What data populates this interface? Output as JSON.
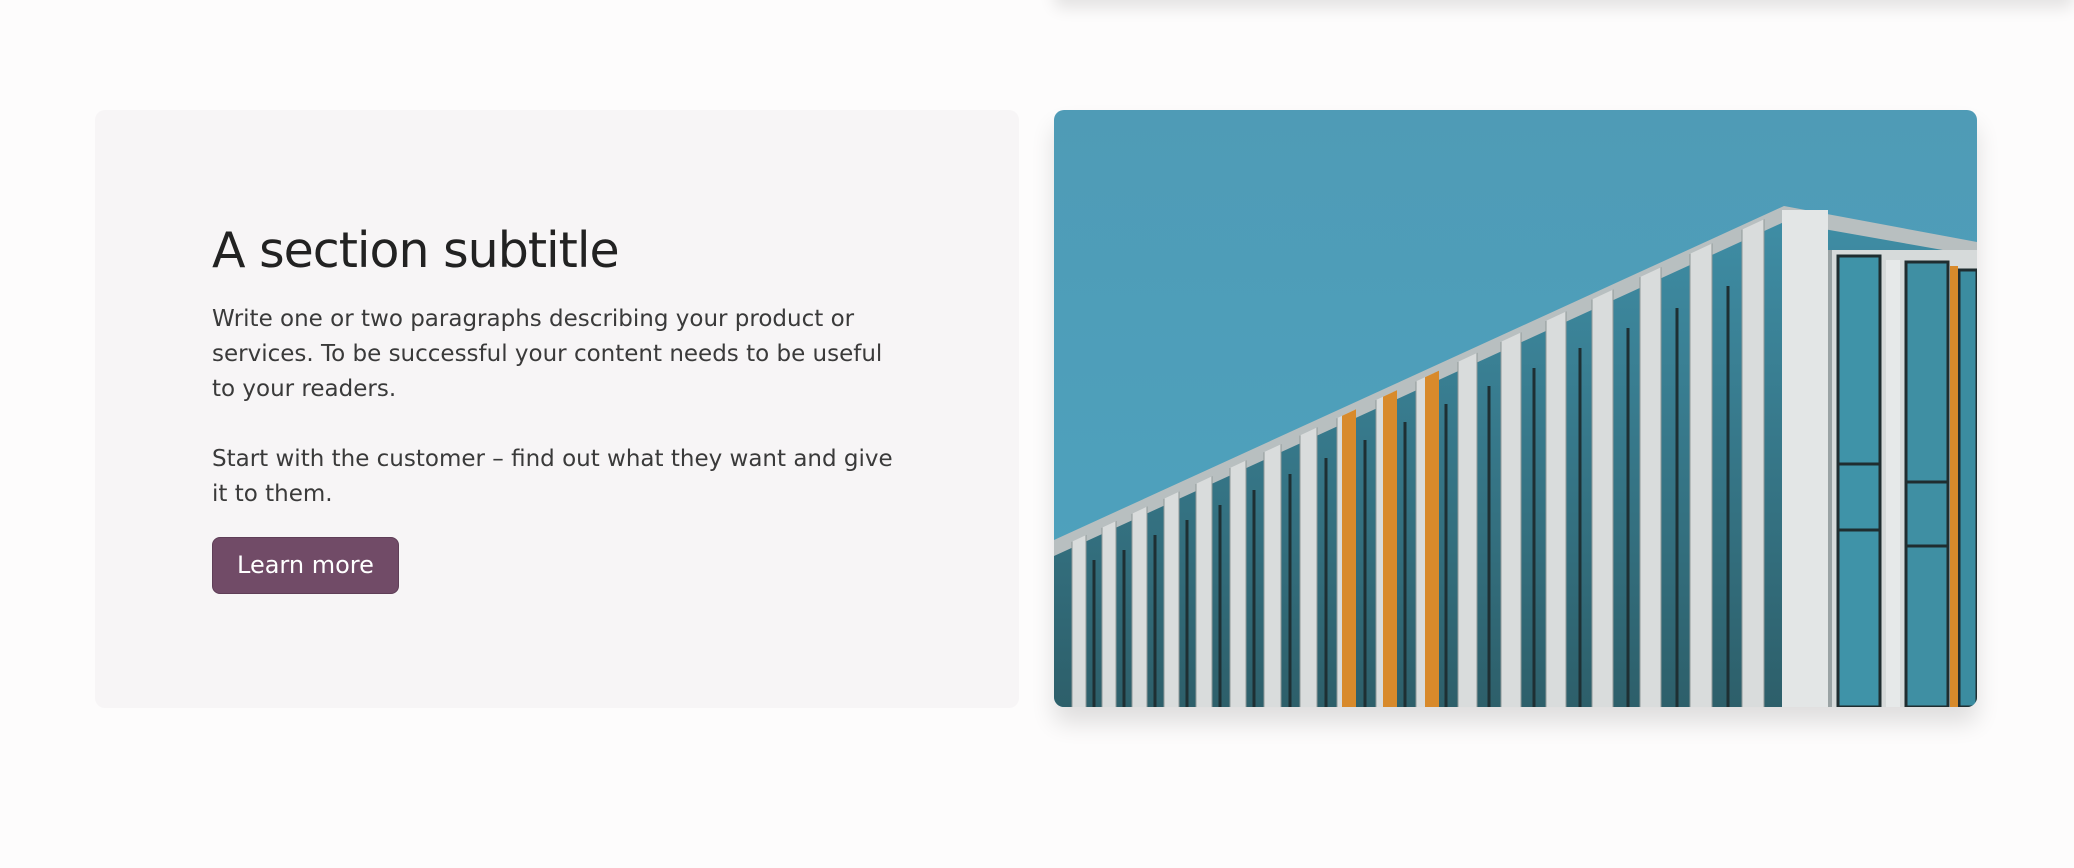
{
  "section": {
    "title": "A section subtitle",
    "paragraph_1": "Write one or two paragraphs describing your product or services. To be successful your content needs to be useful to your readers.",
    "paragraph_2": "Start with the customer – find out what they want and give it to them.",
    "button_label": "Learn more"
  },
  "colors": {
    "button_background": "#714b67",
    "card_background": "#f7f5f6",
    "sky": "#4f9cb8",
    "facade_accent": "#d88a2b"
  },
  "image": {
    "subject": "building-facade"
  }
}
